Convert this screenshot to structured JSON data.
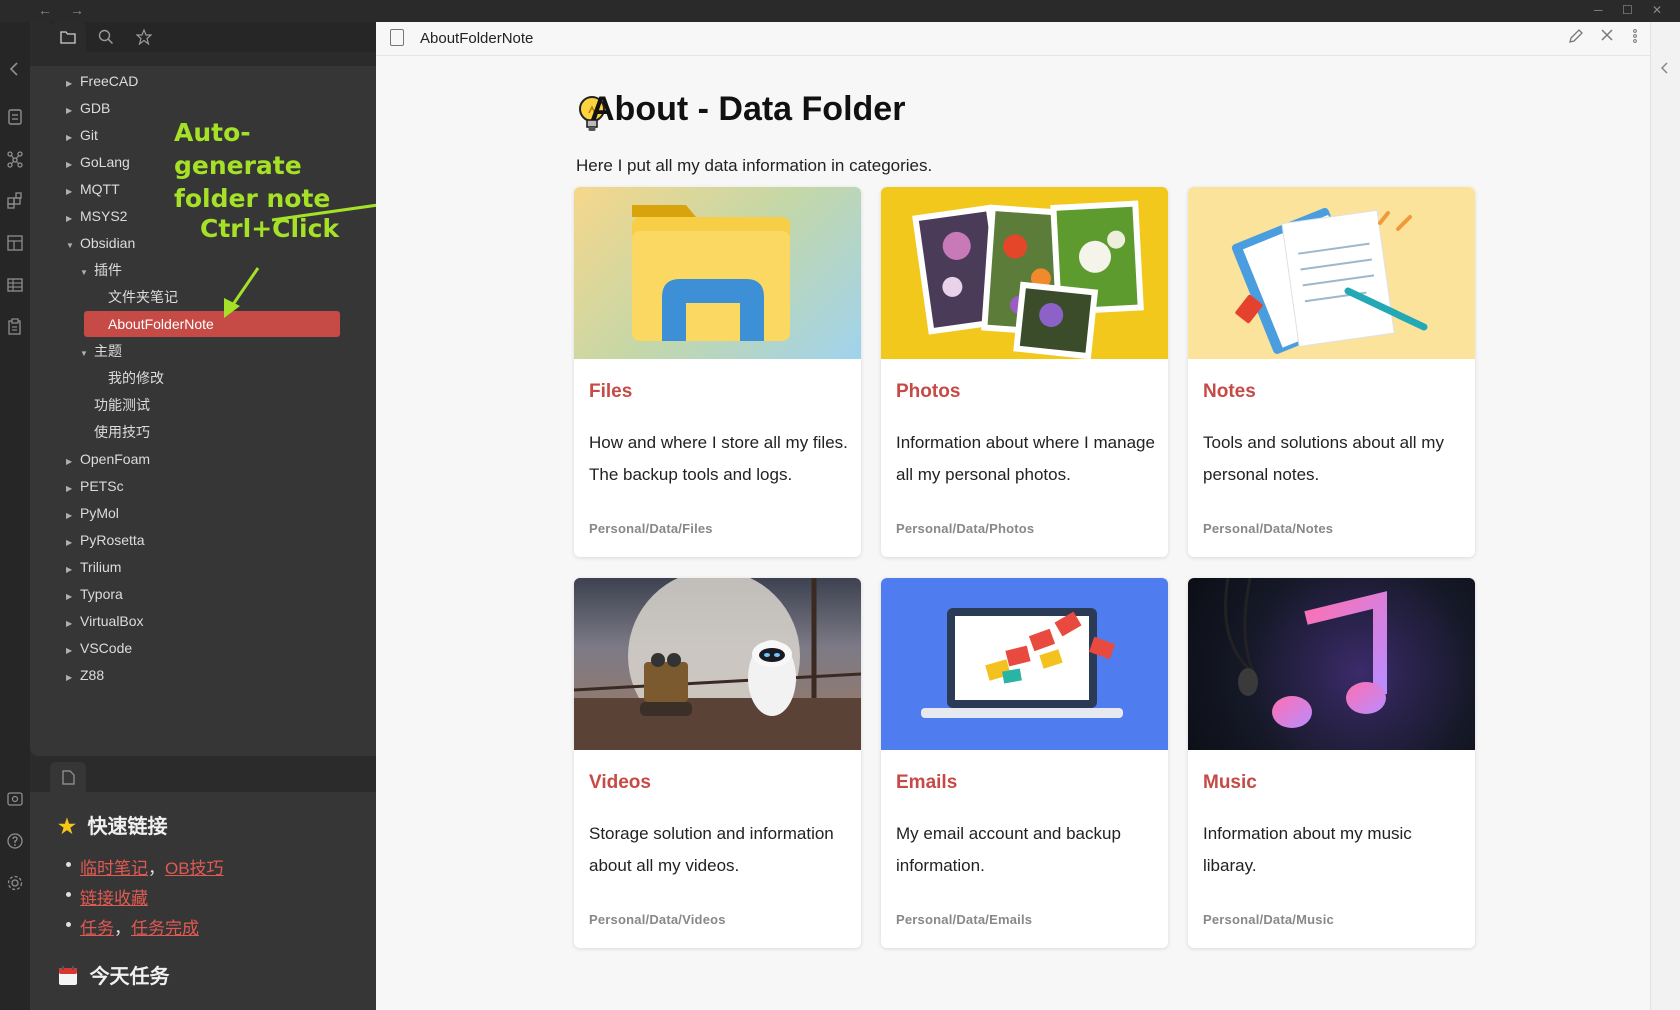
{
  "window": {
    "nav_back": "←",
    "nav_forward": "→",
    "minimize": "─",
    "maximize": "☐",
    "close": "✕"
  },
  "sidebar": {
    "tree": [
      {
        "label": "FreeCAD",
        "level": 0,
        "arrow": "▶"
      },
      {
        "label": "GDB",
        "level": 0,
        "arrow": "▶"
      },
      {
        "label": "Git",
        "level": 0,
        "arrow": "▶"
      },
      {
        "label": "GoLang",
        "level": 0,
        "arrow": "▶"
      },
      {
        "label": "MQTT",
        "level": 0,
        "arrow": "▶"
      },
      {
        "label": "MSYS2",
        "level": 0,
        "arrow": "▶"
      },
      {
        "label": "Obsidian",
        "level": 0,
        "arrow": "▼"
      },
      {
        "label": "插件",
        "level": 1,
        "arrow": "▼"
      },
      {
        "label": "文件夹笔记",
        "level": 2,
        "arrow": ""
      },
      {
        "label": "AboutFolderNote",
        "level": 2,
        "arrow": "",
        "selected": true
      },
      {
        "label": "主题",
        "level": 1,
        "arrow": "▼"
      },
      {
        "label": "我的修改",
        "level": 2,
        "arrow": ""
      },
      {
        "label": "功能测试",
        "level": 1,
        "arrow": ""
      },
      {
        "label": "使用技巧",
        "level": 1,
        "arrow": ""
      },
      {
        "label": "OpenFoam",
        "level": 0,
        "arrow": "▶"
      },
      {
        "label": "PETSc",
        "level": 0,
        "arrow": "▶"
      },
      {
        "label": "PyMol",
        "level": 0,
        "arrow": "▶"
      },
      {
        "label": "PyRosetta",
        "level": 0,
        "arrow": "▶"
      },
      {
        "label": "Trilium",
        "level": 0,
        "arrow": "▶"
      },
      {
        "label": "Typora",
        "level": 0,
        "arrow": "▶"
      },
      {
        "label": "VirtualBox",
        "level": 0,
        "arrow": "▶"
      },
      {
        "label": "VSCode",
        "level": 0,
        "arrow": "▶"
      },
      {
        "label": "Z88",
        "level": 0,
        "arrow": "▶"
      }
    ],
    "annotations": {
      "auto_generate_line1": "Auto-generate",
      "auto_generate_line2": "folder note",
      "ctrl_click": "Ctrl+Click"
    },
    "quick_links": {
      "heading": "快速链接",
      "heading_icon": "★",
      "rows": [
        {
          "items": [
            "临时笔记",
            "OB技巧"
          ]
        },
        {
          "items": [
            "链接收藏"
          ]
        },
        {
          "items": [
            "任务",
            "任务完成"
          ]
        }
      ],
      "separator": "，"
    },
    "today_tasks": {
      "heading": "今天任务"
    }
  },
  "main": {
    "tab_title": "AboutFolderNote",
    "page_title": "About - Data Folder",
    "intro": "Here I put all my data information in categories.",
    "cards": [
      {
        "title": "Files",
        "desc": "How and where I store all my files. The backup tools and logs.",
        "path": "Personal/Data/Files"
      },
      {
        "title": "Photos",
        "desc": "Information about where I manage all my personal photos.",
        "path": "Personal/Data/Photos"
      },
      {
        "title": "Notes",
        "desc": "Tools and solutions about all my personal notes.",
        "path": "Personal/Data/Notes"
      },
      {
        "title": "Videos",
        "desc": "Storage solution and information about all my videos.",
        "path": "Personal/Data/Videos"
      },
      {
        "title": "Emails",
        "desc": "My email account and backup information.",
        "path": "Personal/Data/Emails"
      },
      {
        "title": "Music",
        "desc": "Information about my music libaray.",
        "path": "Personal/Data/Music"
      }
    ]
  },
  "colors": {
    "accent": "#c64a45",
    "annotation": "#a4e127",
    "link": "#e05a52"
  }
}
